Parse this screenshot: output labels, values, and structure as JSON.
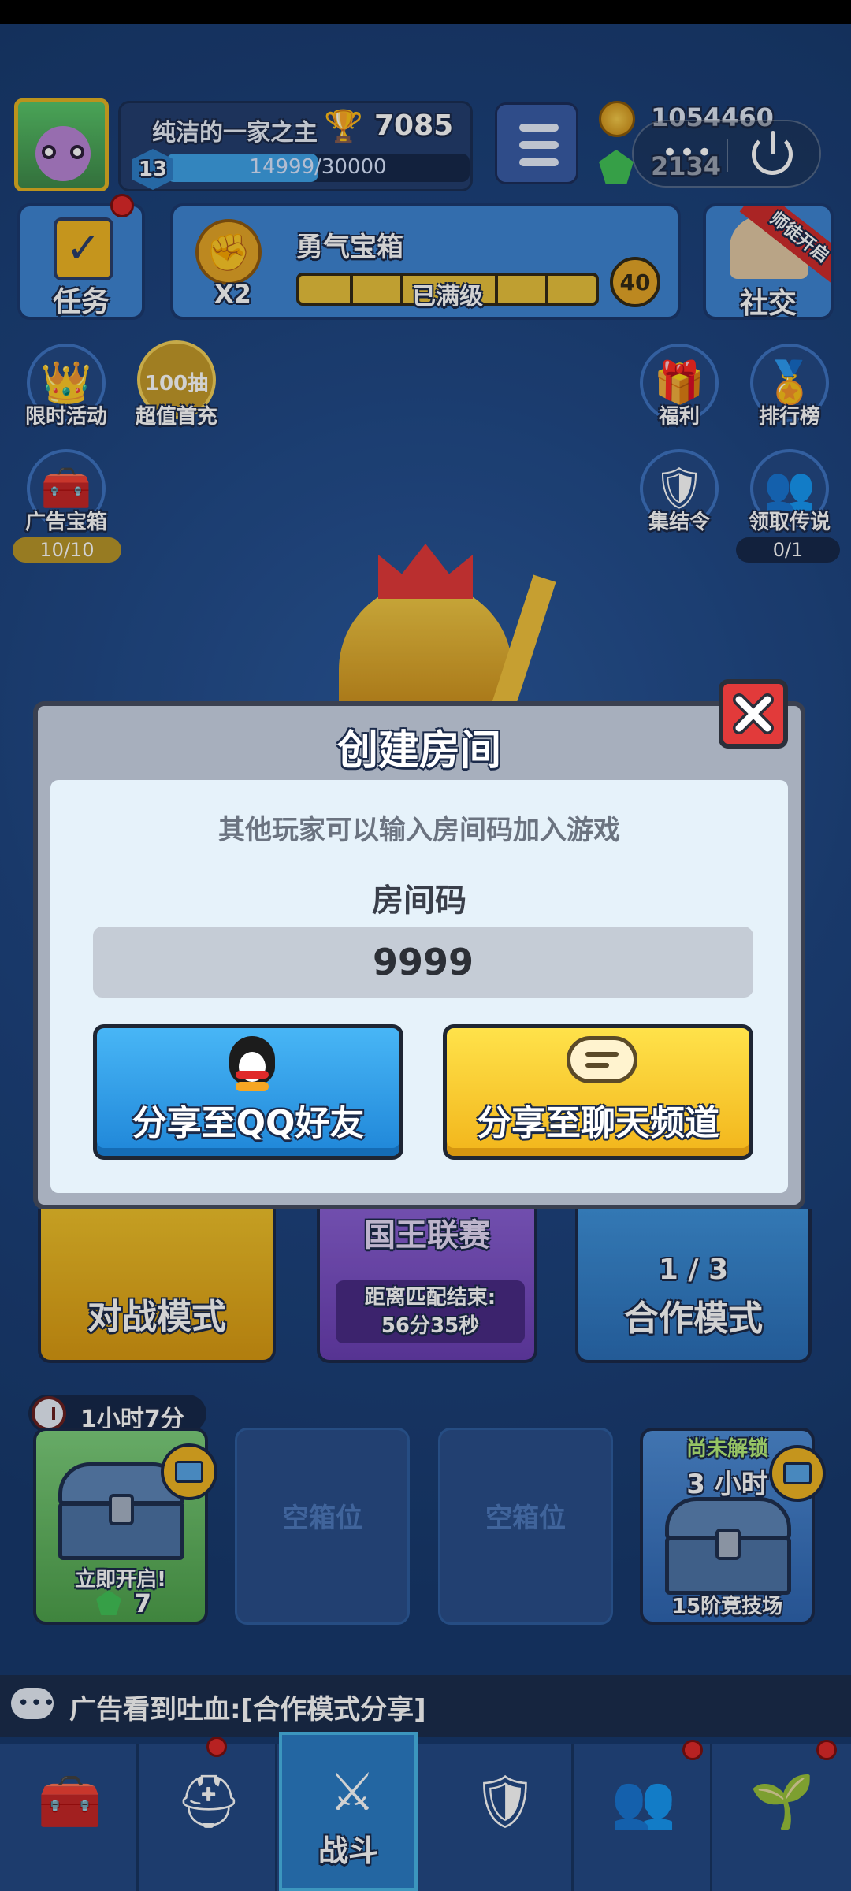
{
  "player": {
    "name": "纯洁的一家之主",
    "trophies": "7085",
    "level": "13",
    "xp": "14999/30000",
    "xp_fraction": 0.5
  },
  "currency": {
    "coins": "1054460",
    "gems": "2134"
  },
  "tasks": {
    "label": "任务"
  },
  "chest_progress": {
    "multiplier": "X2",
    "title": "勇气宝箱",
    "status": "已满级",
    "level": "40"
  },
  "social": {
    "label": "社交",
    "ribbon": "师徒开启"
  },
  "side_left": [
    {
      "name": "limited-event",
      "label": "限时活动",
      "icon": "crown-icon"
    },
    {
      "name": "first-recharge",
      "label": "超值首充",
      "badge": "100抽",
      "icon": "gift-icon"
    },
    {
      "name": "ad-chest",
      "label": "广告宝箱",
      "counter": "10/10",
      "icon": "treasure-icon"
    }
  ],
  "side_right": [
    {
      "name": "welfare",
      "label": "福利",
      "icon": "gift-bag-icon"
    },
    {
      "name": "ranking",
      "label": "排行榜",
      "icon": "podium-icon"
    },
    {
      "name": "rally",
      "label": "集结令",
      "icon": "emblem-icon"
    },
    {
      "name": "claim-legend",
      "label": "领取传说",
      "counter": "0/1",
      "icon": "people-icon"
    }
  ],
  "dialog": {
    "title": "创建房间",
    "hint": "其他玩家可以输入房间码加入游戏",
    "code_label": "房间码",
    "code": "9999",
    "share_qq": "分享至QQ好友",
    "share_chat": "分享至聊天频道"
  },
  "modes": {
    "battle": "对战模式",
    "king_title": "国王联赛",
    "king_timer_label": "距离匹配结束:",
    "king_timer": "56分35秒",
    "coop_count": "1 / 3",
    "coop": "合作模式"
  },
  "timer": "1小时7分",
  "chests": {
    "ready_caption": "立即开启!",
    "ready_cost": "7",
    "empty_label": "空箱位",
    "locked_top": "尚未解锁",
    "locked_time": "3 小时",
    "locked_caption": "15阶竞技场"
  },
  "chat": {
    "message": "广告看到吐血:[合作模式分享]"
  },
  "nav": {
    "active_label": "战斗"
  },
  "colors": {
    "background": "#1d3f74",
    "qq_button": "#1f86d8",
    "chat_button": "#f2b51b",
    "close_button": "#e23a3a"
  }
}
